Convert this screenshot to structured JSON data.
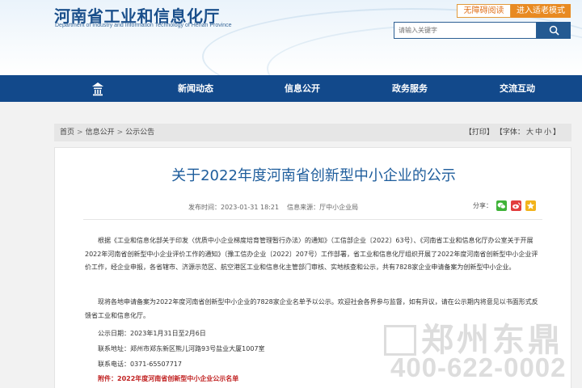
{
  "header": {
    "site_title": "河南省工业和信息化厅",
    "site_subtitle": "Department of Industry and Information Technology of Henan Province",
    "accessibility_label": "无障碍阅读",
    "elder_mode_label": "进入适老模式",
    "search_placeholder": "请输入关键字"
  },
  "nav": {
    "items": [
      "新闻动态",
      "信息公开",
      "政务服务",
      "交流互动"
    ]
  },
  "breadcrumb": {
    "items": [
      "首页",
      "信息公开",
      "公示公告"
    ],
    "separator": ">",
    "print_label": "【打印】",
    "font_label": "【字体：",
    "font_large": "大",
    "font_medium": "中",
    "font_small": "小",
    "font_close": "】"
  },
  "article": {
    "title": "关于2022年度河南省创新型中小企业的公示",
    "publish_time": "发布时间：2023-01-31 18:21",
    "source": "信息来源：厅中小企业局",
    "share_label": "分享：",
    "paragraph_1": "根据《工业和信息化部关于印发〈优质中小企业梯度培育管理暂行办法〉的通知》（工信部企业〔2022〕63号）、《河南省工业和信息化厅办公室关于开展2022年河南省创新型中小企业评价工作的通知》（豫工信办企业〔2022〕207号）工作部署，省工业和信息化厅组织开展了2022年度河南省创新型中小企业评价工作，经企业申报，各省辖市、济源示范区、航空港区工业和信息化主管部门审核、实地核查和公示，共有7828家企业申请备案为创新型中小企业。",
    "paragraph_2": "现将各地申请备案为2022年度河南省创新型中小企业的7828家企业名单予以公示。欢迎社会各界参与监督，如有异议，请在公示期内将意见以书面形式反馈省工业和信息化厅。",
    "notice_date": "公示日期：2023年1月31日至2月6日",
    "contact_address": "联系地址：郑州市郑东新区熊儿河路93号盐业大厦1007室",
    "contact_phone": "联系电话：0371-65507717",
    "attachment": "附件：2022年度河南省创新型中小企业公示名单"
  },
  "watermark": {
    "line1": "郑州东鼎",
    "line2": "400-622-0002"
  },
  "colors": {
    "nav_bg": "#12498b",
    "title_blue": "#1e5d9c",
    "accent_orange": "#e88a22",
    "attachment_red": "#c02020"
  },
  "icons": {
    "search": "search-icon",
    "home": "home-icon",
    "wechat": "wechat-icon",
    "weibo": "weibo-icon",
    "qzone": "qzone-icon"
  }
}
